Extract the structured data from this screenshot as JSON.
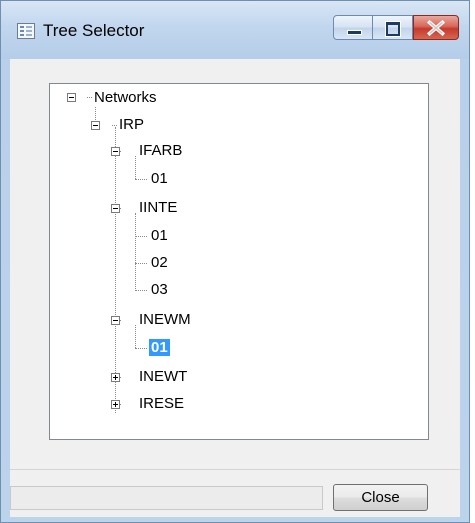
{
  "window": {
    "title": "Tree Selector",
    "title_icon": "tree-window-icon",
    "caption_buttons": [
      "minimize-icon",
      "maximize-icon",
      "close-icon"
    ]
  },
  "tree": {
    "selected_node": "01",
    "nodes": {
      "networks": "Networks",
      "irp": "IRP",
      "ifarb": "IFARB",
      "ifarb_01": "01",
      "iinte": "IINTE",
      "iinte_01": "01",
      "iinte_02": "02",
      "iinte_03": "03",
      "inewm": "INEWM",
      "inewm_01": "01",
      "inewt": "INEWT",
      "irese": "IRESE"
    }
  },
  "footer": {
    "close_label": "Close",
    "status_text": ""
  },
  "colors": {
    "selection": "#3399ff",
    "title_gradient_top": "#d8e6f5",
    "close_button_red": "#c43b2d"
  }
}
